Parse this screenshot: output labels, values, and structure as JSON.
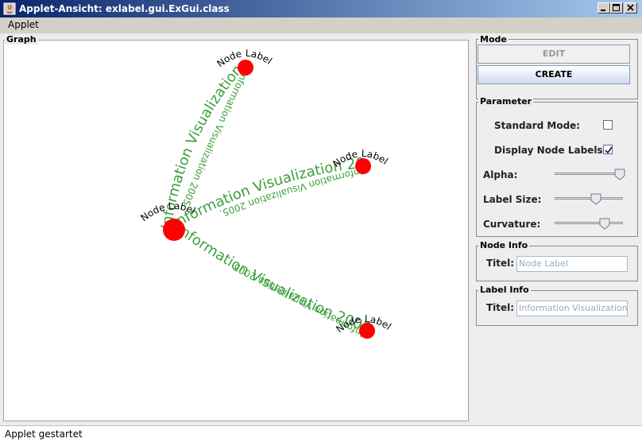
{
  "window": {
    "title": "Applet-Ansicht: exlabel.gui.ExGui.class"
  },
  "menu": {
    "items": [
      "Applet"
    ]
  },
  "graph": {
    "legend": "Graph",
    "nodes": [
      {
        "id": "n1",
        "label": "Node Label"
      },
      {
        "id": "n2",
        "label": "Node Label"
      },
      {
        "id": "n3",
        "label": "Node Label"
      },
      {
        "id": "n4",
        "label": "Node Label"
      }
    ],
    "edges": [
      {
        "from": "n1",
        "to": "n2",
        "label": "Information Visualization 2005."
      },
      {
        "from": "n1",
        "to": "n3",
        "label": "Information Visualization 2005."
      },
      {
        "from": "n1",
        "to": "n4",
        "label": "Information Visualization 2005."
      },
      {
        "from": "n2",
        "to": "n1",
        "label": "Information Visualization 2005."
      },
      {
        "from": "n3",
        "to": "n1",
        "label": "Information Visualization 2005."
      },
      {
        "from": "n4",
        "to": "n1",
        "label": "Information Visualization 2005."
      }
    ],
    "colors": {
      "node": "#ff0000",
      "edge_text": "#3c9f3c"
    }
  },
  "mode": {
    "legend": "Mode",
    "edit_label": "EDIT",
    "create_label": "CREATE"
  },
  "parameter": {
    "legend": "Parameter",
    "standard_mode_label": "Standard Mode:",
    "standard_mode_checked": false,
    "display_labels_label": "Display Node Labels:",
    "display_labels_checked": true,
    "alpha_label": "Alpha:",
    "alpha_value": 1.0,
    "label_size_label": "Label Size:",
    "label_size_value": 0.62,
    "curvature_label": "Curvature:",
    "curvature_value": 0.75
  },
  "node_info": {
    "legend": "Node Info",
    "titel_label": "Titel:",
    "titel_value": "Node Label"
  },
  "label_info": {
    "legend": "Label Info",
    "titel_label": "Titel:",
    "titel_value": "Information Visualization"
  },
  "status": {
    "text": "Applet gestartet"
  }
}
